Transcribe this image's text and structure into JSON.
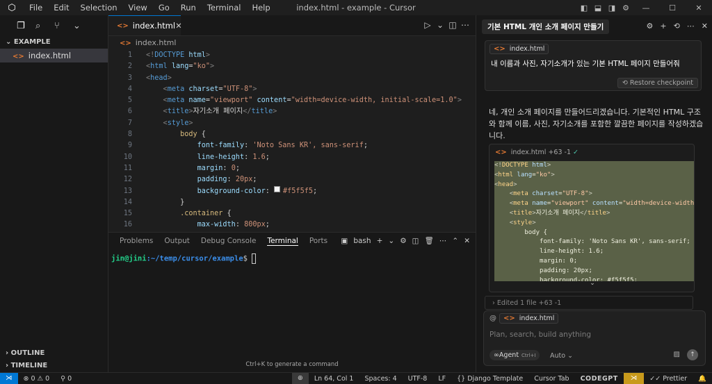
{
  "titlebar": {
    "title": "index.html - example - Cursor",
    "menu": [
      "File",
      "Edit",
      "Selection",
      "View",
      "Go",
      "Run",
      "Terminal",
      "Help"
    ]
  },
  "sidebar": {
    "section": "EXAMPLE",
    "file": "index.html",
    "outline": "OUTLINE",
    "timeline": "TIMELINE"
  },
  "editor": {
    "tab": "index.html",
    "breadcrumb": "index.html",
    "lines": [
      {
        "n": "1",
        "c": [
          [
            "p",
            "<!"
          ],
          [
            "t",
            "DOCTYPE"
          ],
          [
            "a",
            " html"
          ],
          [
            "p",
            ">"
          ]
        ]
      },
      {
        "n": "2",
        "c": [
          [
            "p",
            "<"
          ],
          [
            "t",
            "html"
          ],
          [
            "a",
            " lang"
          ],
          [
            "w",
            "="
          ],
          [
            "s",
            "\"ko\""
          ],
          [
            "p",
            ">"
          ]
        ]
      },
      {
        "n": "3",
        "c": [
          [
            "p",
            "<"
          ],
          [
            "t",
            "head"
          ],
          [
            "p",
            ">"
          ]
        ]
      },
      {
        "n": "4",
        "c": [
          [
            "w",
            "    "
          ],
          [
            "p",
            "<"
          ],
          [
            "t",
            "meta"
          ],
          [
            "a",
            " charset"
          ],
          [
            "w",
            "="
          ],
          [
            "s",
            "\"UTF-8\""
          ],
          [
            "p",
            ">"
          ]
        ]
      },
      {
        "n": "5",
        "c": [
          [
            "w",
            "    "
          ],
          [
            "p",
            "<"
          ],
          [
            "t",
            "meta"
          ],
          [
            "a",
            " name"
          ],
          [
            "w",
            "="
          ],
          [
            "s",
            "\"viewport\""
          ],
          [
            "a",
            " content"
          ],
          [
            "w",
            "="
          ],
          [
            "s",
            "\"width=device-width, initial-scale=1.0\""
          ],
          [
            "p",
            ">"
          ]
        ]
      },
      {
        "n": "6",
        "c": [
          [
            "w",
            "    "
          ],
          [
            "p",
            "<"
          ],
          [
            "t",
            "title"
          ],
          [
            "p",
            ">"
          ],
          [
            "w",
            "자기소개 페이지"
          ],
          [
            "p",
            "</"
          ],
          [
            "t",
            "title"
          ],
          [
            "p",
            ">"
          ]
        ]
      },
      {
        "n": "7",
        "c": [
          [
            "w",
            "    "
          ],
          [
            "p",
            "<"
          ],
          [
            "t",
            "style"
          ],
          [
            "p",
            ">"
          ]
        ]
      },
      {
        "n": "8",
        "c": [
          [
            "w",
            "        "
          ],
          [
            "sel",
            "body"
          ],
          [
            "w",
            " {"
          ]
        ]
      },
      {
        "n": "9",
        "c": [
          [
            "w",
            "            "
          ],
          [
            "k",
            "font-family"
          ],
          [
            "w",
            ": "
          ],
          [
            "v",
            "'Noto Sans KR', sans-serif"
          ],
          [
            "w",
            ";"
          ]
        ]
      },
      {
        "n": "10",
        "c": [
          [
            "w",
            "            "
          ],
          [
            "k",
            "line-height"
          ],
          [
            "w",
            ": "
          ],
          [
            "v",
            "1.6"
          ],
          [
            "w",
            ";"
          ]
        ]
      },
      {
        "n": "11",
        "c": [
          [
            "w",
            "            "
          ],
          [
            "k",
            "margin"
          ],
          [
            "w",
            ": "
          ],
          [
            "v",
            "0"
          ],
          [
            "w",
            ";"
          ]
        ]
      },
      {
        "n": "12",
        "c": [
          [
            "w",
            "            "
          ],
          [
            "k",
            "padding"
          ],
          [
            "w",
            ": "
          ],
          [
            "v",
            "20px"
          ],
          [
            "w",
            ";"
          ]
        ]
      },
      {
        "n": "13",
        "c": [
          [
            "w",
            "            "
          ],
          [
            "k",
            "background-color"
          ],
          [
            "w",
            ": "
          ],
          [
            "sw",
            ""
          ],
          [
            "v",
            "#f5f5f5"
          ],
          [
            "w",
            ";"
          ]
        ]
      },
      {
        "n": "14",
        "c": [
          [
            "w",
            "        }"
          ]
        ]
      },
      {
        "n": "15",
        "c": [
          [
            "w",
            "        "
          ],
          [
            "sel",
            ".container"
          ],
          [
            "w",
            " {"
          ]
        ]
      },
      {
        "n": "16",
        "c": [
          [
            "w",
            "            "
          ],
          [
            "k",
            "max-width"
          ],
          [
            "w",
            ": "
          ],
          [
            "v",
            "800px"
          ],
          [
            "w",
            ";"
          ]
        ]
      }
    ]
  },
  "panel": {
    "tabs": [
      "Problems",
      "Output",
      "Debug Console",
      "Terminal",
      "Ports"
    ],
    "active": "Terminal",
    "shell": "bash",
    "prompt_user": "jin@jini",
    "prompt_path": ":~/temp/cursor/example",
    "prompt_sym": "$ ",
    "hint": "Ctrl+K to generate a command"
  },
  "chat": {
    "tab_title": "기본 HTML 개인 소개 페이지 만들기",
    "context_file": "index.html",
    "user_msg": "내 이름과 사진, 자기소개가 있는 기본 HTML 페이지 만들어줘",
    "restore": "Restore checkpoint",
    "reply": "네, 개인 소개 페이지를 만들어드리겠습니다. 기본적인 HTML 구조와 함께 이름, 사진, 자기소개를 포함한 깔끔한 페이지를 작성하겠습니다.",
    "block_file": "index.html",
    "block_diff": "+63 -1",
    "block_lines": [
      {
        "c": [
          [
            "p",
            "<!"
          ],
          [
            "t",
            "DOCTYPE"
          ],
          [
            "a",
            " html"
          ],
          [
            "p",
            ">"
          ]
        ]
      },
      {
        "c": [
          [
            "p",
            "<"
          ],
          [
            "t",
            "html"
          ],
          [
            "a",
            " lang"
          ],
          [
            "w",
            "="
          ],
          [
            "s",
            "\"ko\""
          ],
          [
            "p",
            ">"
          ]
        ]
      },
      {
        "c": [
          [
            "p",
            "<"
          ],
          [
            "t",
            "head"
          ],
          [
            "p",
            ">"
          ]
        ]
      },
      {
        "c": [
          [
            "w",
            "    "
          ],
          [
            "p",
            "<"
          ],
          [
            "t",
            "meta"
          ],
          [
            "a",
            " charset"
          ],
          [
            "w",
            "="
          ],
          [
            "s",
            "\"UTF-8\""
          ],
          [
            "p",
            ">"
          ]
        ]
      },
      {
        "c": [
          [
            "w",
            "    "
          ],
          [
            "p",
            "<"
          ],
          [
            "t",
            "meta"
          ],
          [
            "a",
            " name"
          ],
          [
            "w",
            "="
          ],
          [
            "s",
            "\"viewport\""
          ],
          [
            "a",
            " content"
          ],
          [
            "w",
            "="
          ],
          [
            "s",
            "\"width=device-width, init"
          ]
        ]
      },
      {
        "c": [
          [
            "w",
            "    "
          ],
          [
            "p",
            "<"
          ],
          [
            "t",
            "title"
          ],
          [
            "p",
            ">"
          ],
          [
            "w",
            "자기소개 페이지"
          ],
          [
            "p",
            "</"
          ],
          [
            "t",
            "title"
          ],
          [
            "p",
            ">"
          ]
        ]
      },
      {
        "c": [
          [
            "w",
            "    "
          ],
          [
            "p",
            "<"
          ],
          [
            "t",
            "style"
          ],
          [
            "p",
            ">"
          ]
        ]
      },
      {
        "c": [
          [
            "w",
            "        body {"
          ]
        ]
      },
      {
        "c": [
          [
            "w",
            "            font-family: 'Noto Sans KR', sans-serif;"
          ]
        ]
      },
      {
        "c": [
          [
            "w",
            "            line-height: 1.6;"
          ]
        ]
      },
      {
        "c": [
          [
            "w",
            "            margin: 0;"
          ]
        ]
      },
      {
        "c": [
          [
            "w",
            "            padding: 20px;"
          ]
        ]
      },
      {
        "c": [
          [
            "w",
            "            background-color: #f5f5f5;"
          ]
        ]
      }
    ],
    "edited": "Edited 1 file +63 -1",
    "input_file": "index.html",
    "placeholder": "Plan, search, build anything",
    "agent": "Agent",
    "agent_kbd": "Ctrl+I",
    "model": "Auto"
  },
  "statusbar": {
    "errors": "0",
    "warnings": "0",
    "ports": "0",
    "position": "Ln 64, Col 1",
    "spaces": "Spaces: 4",
    "encoding": "UTF-8",
    "eol": "LF",
    "language": "Django Template",
    "cursor_tab": "Cursor Tab",
    "codegpt": "CODEGPT",
    "prettier": "Prettier"
  }
}
